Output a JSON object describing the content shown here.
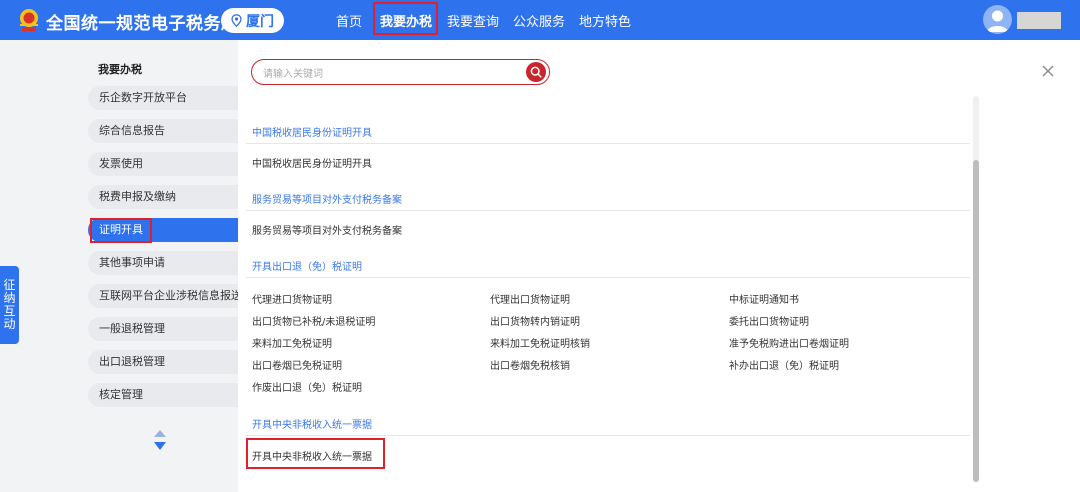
{
  "header": {
    "site_title": "全国统一规范电子税务局",
    "region": "厦门",
    "nav": [
      "首页",
      "我要办税",
      "我要查询",
      "公众服务",
      "地方特色"
    ],
    "accent_color": "#2e72ee"
  },
  "side_tab": {
    "chars": [
      "征",
      "纳",
      "互",
      "动"
    ]
  },
  "sidebar": {
    "title": "我要办税",
    "items": [
      "乐企数字开放平台",
      "综合信息报告",
      "发票使用",
      "税费申报及缴纳",
      "证明开具",
      "其他事项申请",
      "互联网平台企业涉税信息报送",
      "一般退税管理",
      "出口退税管理",
      "核定管理"
    ],
    "active_index": 4
  },
  "search": {
    "placeholder": "请输入关键词"
  },
  "content": {
    "sections": [
      {
        "title": "中国税收居民身份证明开具",
        "links": [
          "中国税收居民身份证明开具"
        ]
      },
      {
        "title": "服务贸易等项目对外支付税务备案",
        "links": [
          "服务贸易等项目对外支付税务备案"
        ]
      },
      {
        "title": "开具出口退（免）税证明",
        "links": [
          "代理进口货物证明",
          "代理出口货物证明",
          "中标证明通知书",
          "出口货物已补税/未退税证明",
          "出口货物转内销证明",
          "委托出口货物证明",
          "来料加工免税证明",
          "来料加工免税证明核销",
          "准予免税购进出口卷烟证明",
          "出口卷烟已免税证明",
          "出口卷烟免税核销",
          "补办出口退（免）税证明",
          "作废出口退（免）税证明"
        ]
      },
      {
        "title": "开具中央非税收入统一票据",
        "links": [
          "开具中央非税收入统一票据"
        ]
      }
    ]
  }
}
